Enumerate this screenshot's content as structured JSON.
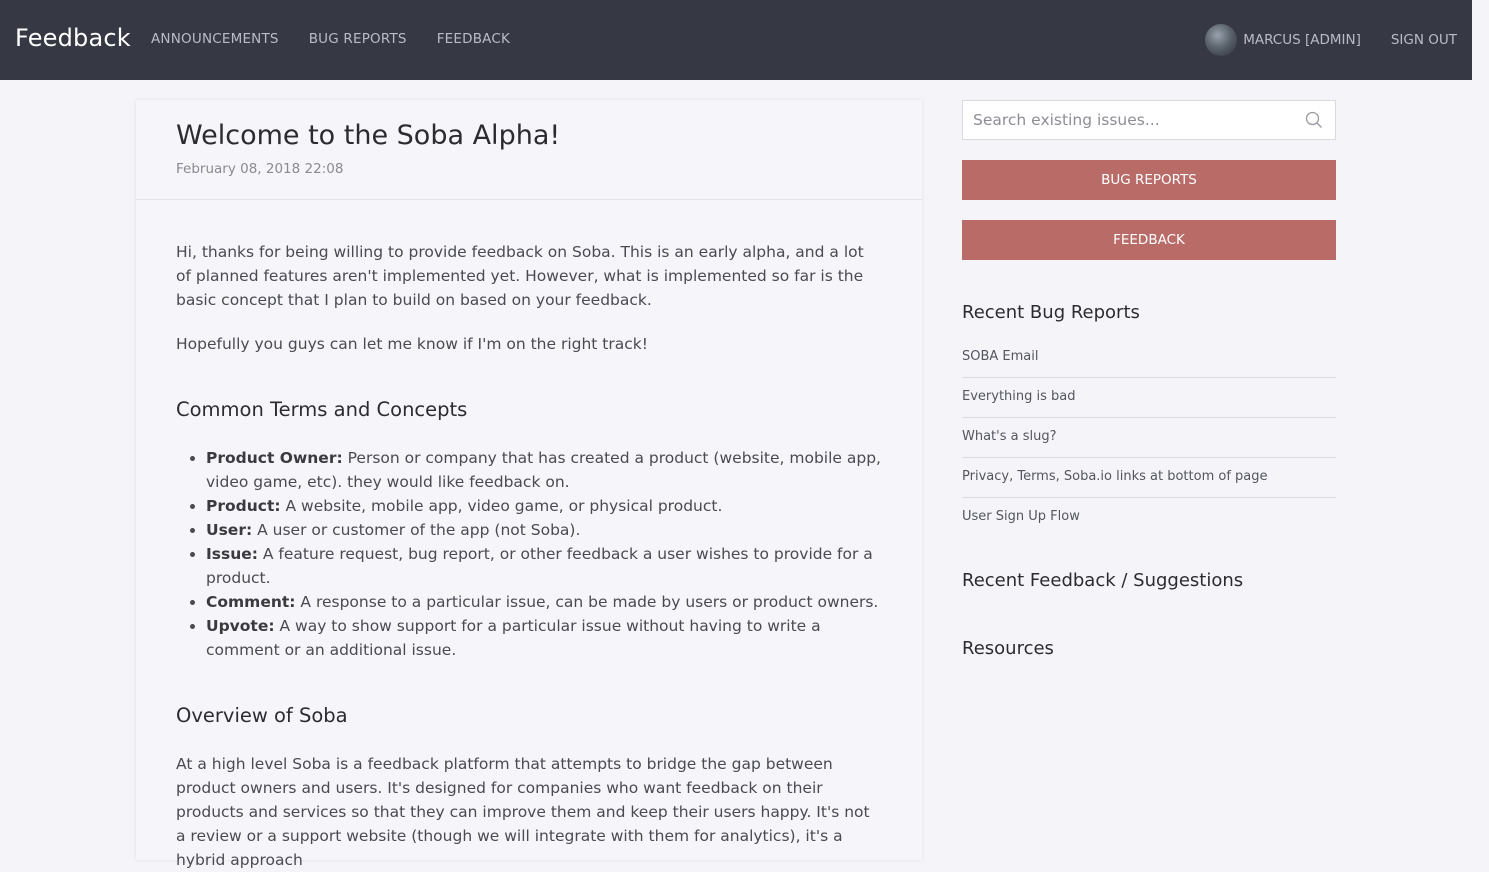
{
  "nav": {
    "brand": "Feedback",
    "links": [
      "ANNOUNCEMENTS",
      "BUG REPORTS",
      "FEEDBACK"
    ],
    "user": "MARCUS [ADMIN]",
    "signout": "SIGN OUT"
  },
  "post": {
    "title": "Welcome to the Soba Alpha!",
    "date": "February 08, 2018 22:08",
    "intro": [
      "Hi, thanks for being willing to provide feedback on Soba. This is an early alpha, and a lot of planned features aren't implemented yet. However, what is implemented so far is the basic concept that I plan to build on based on your feedback.",
      "Hopefully you guys can let me know if I'm on the right track!"
    ],
    "terms_heading": "Common Terms and Concepts",
    "terms": [
      {
        "name": "Product Owner:",
        "desc": "Person or company that has created a product (website, mobile app, video game, etc). they would like feedback on."
      },
      {
        "name": "Product:",
        "desc": "A website, mobile app, video game, or physical product."
      },
      {
        "name": "User:",
        "desc": "A user or customer of the app (not Soba)."
      },
      {
        "name": "Issue:",
        "desc": "A feature request, bug report, or other feedback a user wishes to provide for a product."
      },
      {
        "name": "Comment:",
        "desc": "A response to a particular issue, can be made by users or product owners."
      },
      {
        "name": "Upvote:",
        "desc": "A way to show support for a particular issue without having to write a comment or an additional issue."
      }
    ],
    "overview_heading": "Overview of Soba",
    "overview_text": "At a high level Soba is a feedback platform that attempts to bridge the gap between product owners and users. It's designed for companies who want feedback on their products and services so that they can improve them and keep their users happy. It's not a review or a support website (though we will integrate with them for analytics), it's a hybrid approach"
  },
  "sidebar": {
    "search_placeholder": "Search existing issues...",
    "bug_reports_button": "BUG REPORTS",
    "feedback_button": "FEEDBACK",
    "recent_bugs_heading": "Recent Bug Reports",
    "recent_bugs": [
      "SOBA Email",
      "Everything is bad",
      "What's a slug?",
      "Privacy, Terms, Soba.io links at bottom of page",
      "User Sign Up Flow"
    ],
    "recent_feedback_heading": "Recent Feedback / Suggestions",
    "resources_heading": "Resources"
  },
  "colors": {
    "navbar": "#363943",
    "accent_button": "#b86b67",
    "page_background": "#f4f4f9"
  }
}
